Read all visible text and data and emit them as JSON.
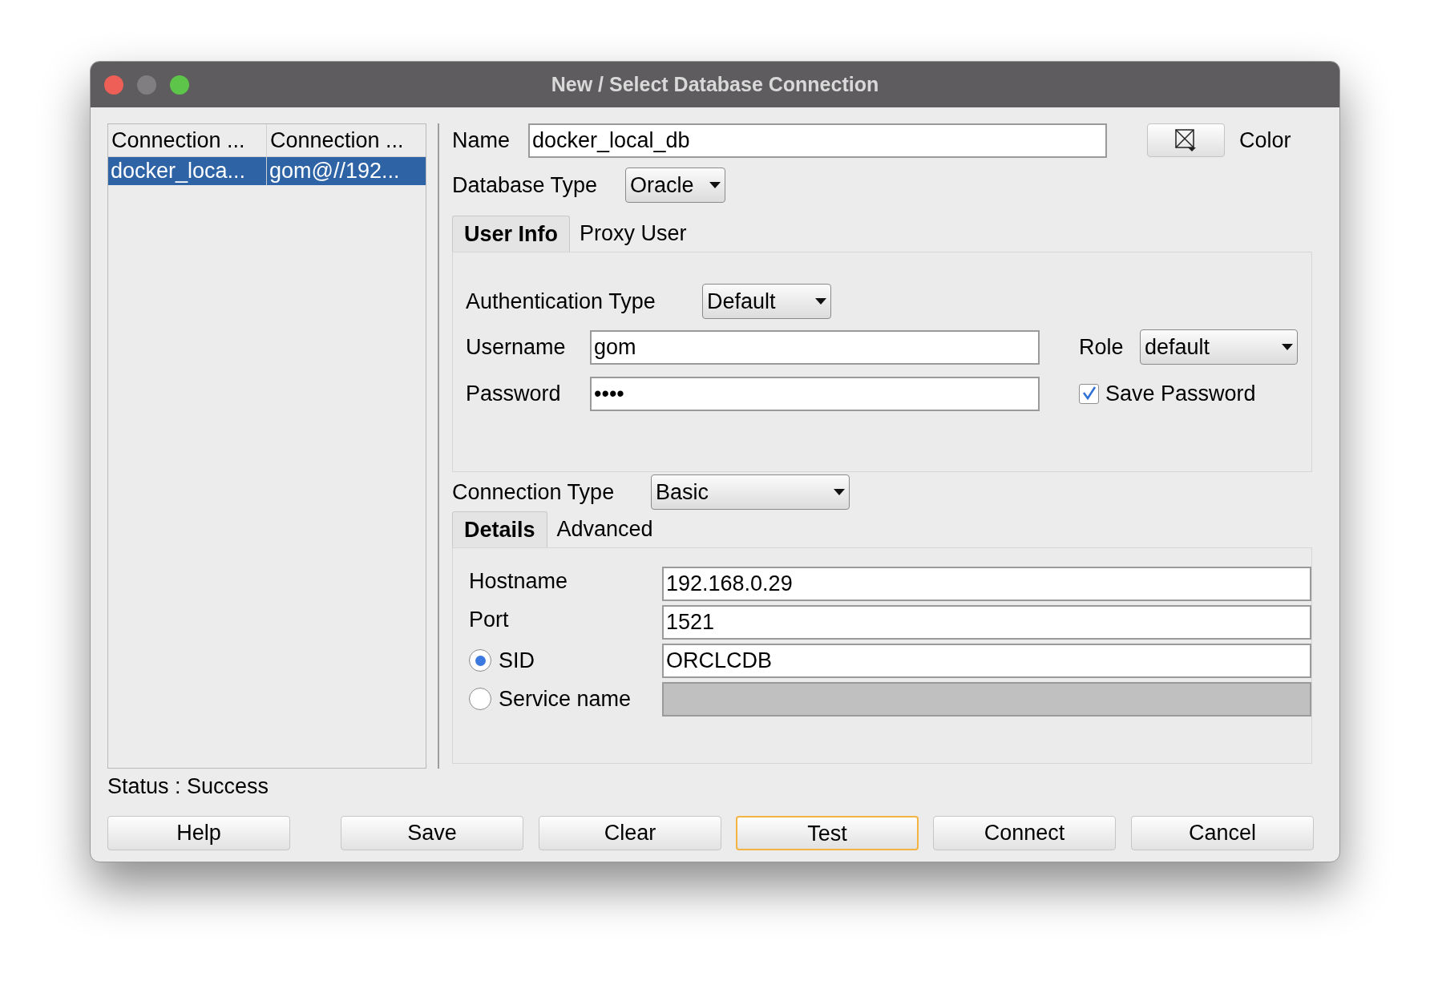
{
  "window": {
    "title": "New / Select Database Connection"
  },
  "connections": {
    "columns": [
      "Connection ...",
      "Connection ..."
    ],
    "rows": [
      {
        "cells": [
          "docker_loca...",
          "gom@//192..."
        ],
        "selected": true
      }
    ]
  },
  "name": {
    "label": "Name",
    "value": "docker_local_db"
  },
  "color_button": {
    "label": "Color"
  },
  "database_type": {
    "label": "Database Type",
    "value": "Oracle"
  },
  "tabs": [
    {
      "label": "User Info",
      "selected": true
    },
    {
      "label": "Proxy User",
      "selected": false
    }
  ],
  "user_info": {
    "authentication_type": {
      "label": "Authentication Type",
      "value": "Default"
    },
    "username": {
      "label": "Username",
      "value": "gom"
    },
    "role": {
      "label": "Role",
      "value": "default"
    },
    "password": {
      "label": "Password",
      "value": "••••"
    },
    "save_password": {
      "label": "Save Password",
      "checked": true
    }
  },
  "connection_type": {
    "label": "Connection Type",
    "value": "Basic"
  },
  "detail_tabs": [
    {
      "label": "Details",
      "selected": true
    },
    {
      "label": "Advanced",
      "selected": false
    }
  ],
  "details": [
    {
      "kind": "text",
      "label": "Hostname",
      "value": "192.168.0.29",
      "disabled": false
    },
    {
      "kind": "text",
      "label": "Port",
      "value": "1521",
      "disabled": false
    },
    {
      "kind": "radio",
      "label": "SID",
      "selected": true,
      "value": "ORCLCDB",
      "disabled": false
    },
    {
      "kind": "radio",
      "label": "Service name",
      "selected": false,
      "disabled": true
    }
  ],
  "status": "Status : Success",
  "buttons": [
    {
      "label": "Help",
      "focused": false
    },
    {
      "label": "Save",
      "focused": false
    },
    {
      "label": "Clear",
      "focused": false
    },
    {
      "label": "Test",
      "focused": true
    },
    {
      "label": "Connect",
      "focused": false
    },
    {
      "label": "Cancel",
      "focused": false
    }
  ]
}
